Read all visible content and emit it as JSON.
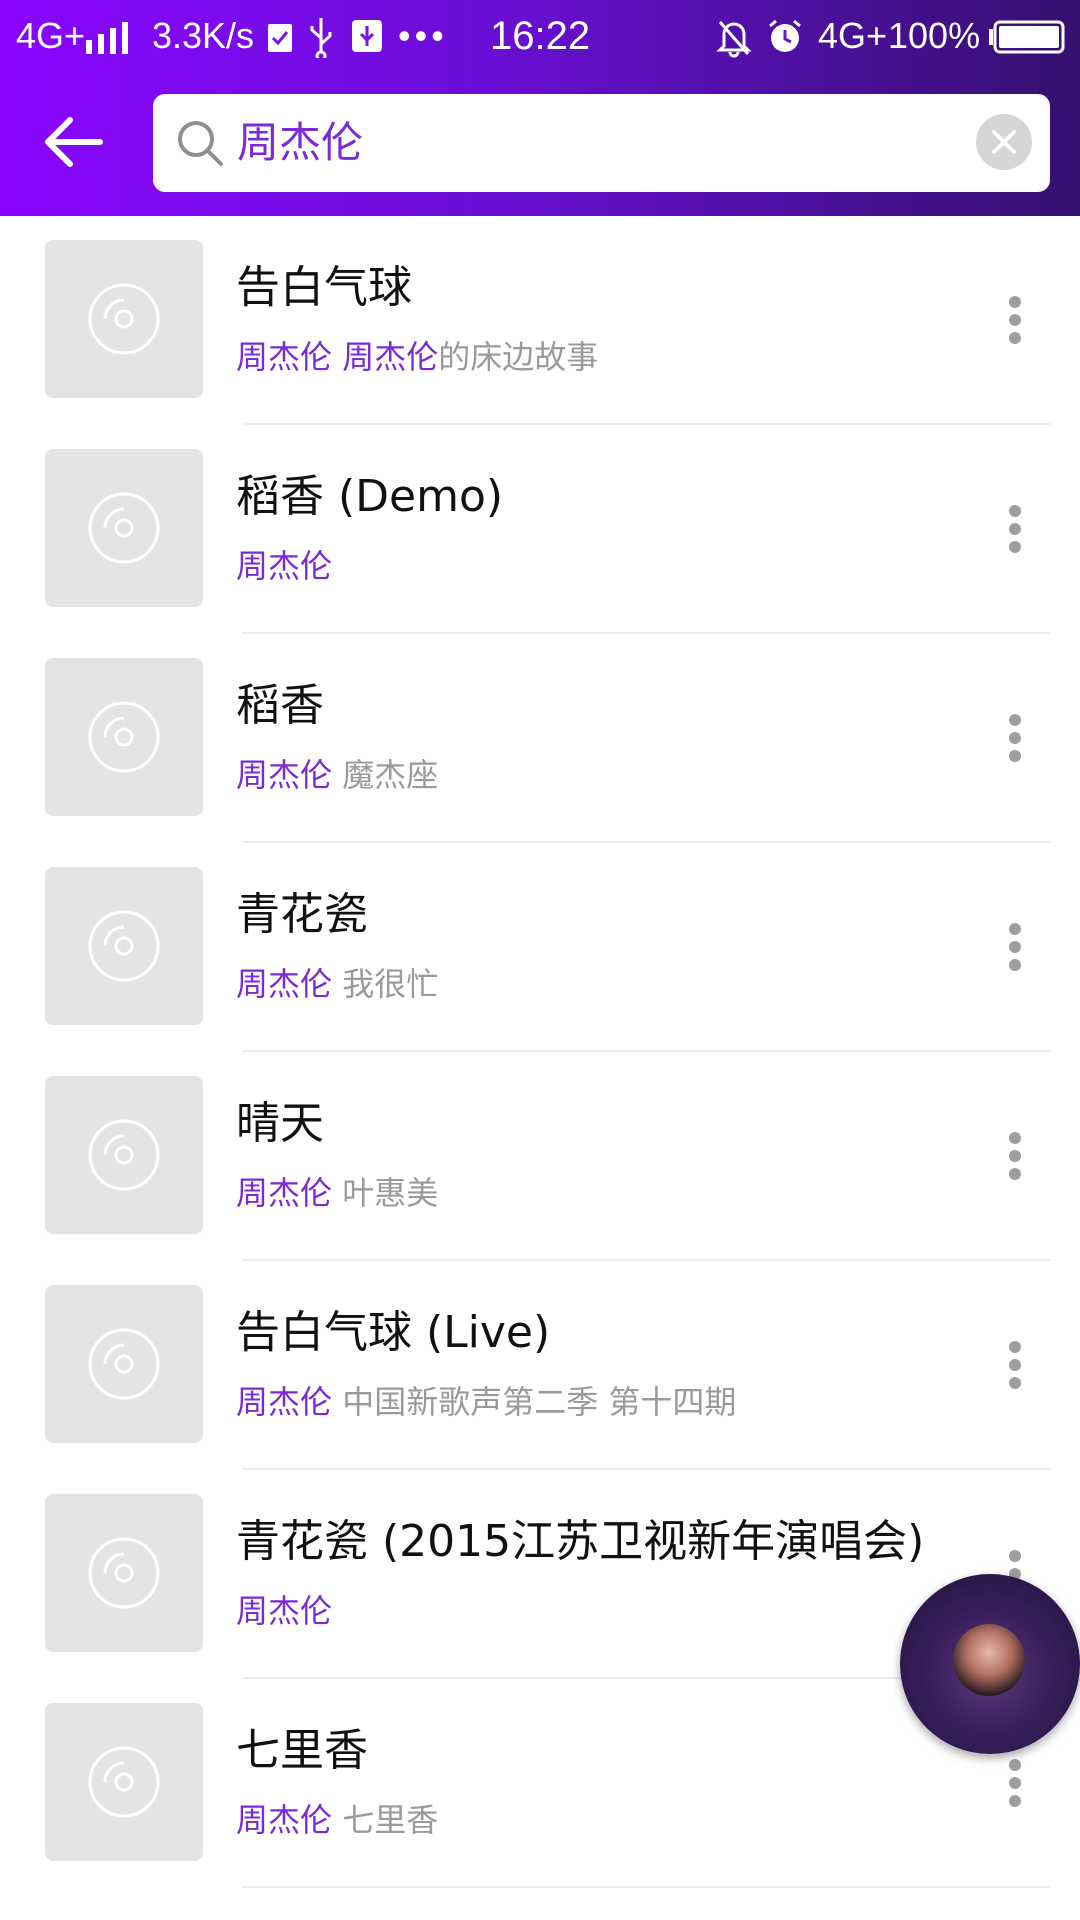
{
  "status_bar": {
    "network": "4G+",
    "speed": "3.3K/s",
    "dots": "•••",
    "time": "16:22",
    "network2": "4G+",
    "battery": "100%",
    "icons": [
      "signal-icon",
      "notification-icon",
      "usb-icon",
      "usb-debug-icon",
      "mute-icon",
      "alarm-icon",
      "battery-icon"
    ]
  },
  "search": {
    "query": "周杰伦",
    "back_icon": "back-arrow-icon",
    "search_icon": "search-icon",
    "clear_icon": "clear-icon"
  },
  "songs": [
    {
      "title": "告白气球",
      "artist": "周杰伦",
      "album_artist": "周杰伦",
      "album_rest": "的床边故事"
    },
    {
      "title": "稻香 (Demo)",
      "artist": "周杰伦",
      "album_artist": "",
      "album_rest": ""
    },
    {
      "title": "稻香",
      "artist": "周杰伦",
      "album_artist": "",
      "album_rest": "魔杰座"
    },
    {
      "title": "青花瓷",
      "artist": "周杰伦",
      "album_artist": "",
      "album_rest": "我很忙"
    },
    {
      "title": "晴天",
      "artist": "周杰伦",
      "album_artist": "",
      "album_rest": "叶惠美"
    },
    {
      "title": "告白气球 (Live)",
      "artist": "周杰伦",
      "album_artist": "",
      "album_rest": "中国新歌声第二季 第十四期"
    },
    {
      "title": "青花瓷 (2015江苏卫视新年演唱会)",
      "artist": "周杰伦",
      "album_artist": "",
      "album_rest": ""
    },
    {
      "title": "七里香",
      "artist": "周杰伦",
      "album_artist": "",
      "album_rest": "七里香"
    }
  ],
  "colors": {
    "accent": "#7b2bd6",
    "header_start": "#8a05ff",
    "header_end": "#34106e",
    "secondary_text": "#9a9a9a"
  }
}
